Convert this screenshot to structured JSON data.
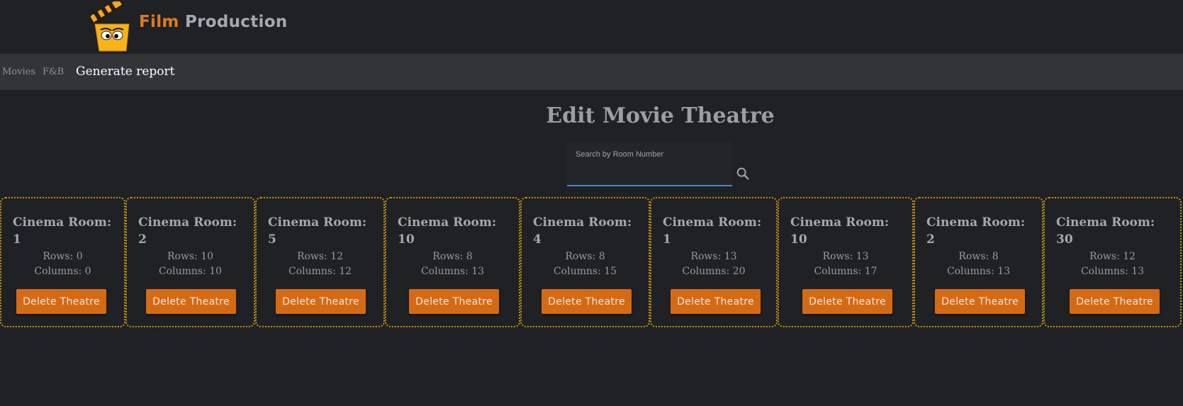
{
  "brand": {
    "word1": "Film",
    "word2": "Production",
    "logo_icon": "clapperboard-mascot-icon",
    "colors": {
      "orange": "#e07a20",
      "grey": "#a7a9ac"
    }
  },
  "nav": {
    "movies": "Movies",
    "fnb": "F&B",
    "report": "Generate report"
  },
  "page": {
    "title": "Edit Movie Theatre"
  },
  "search": {
    "label": "Search by Room Number",
    "value": "",
    "icon": "search-icon",
    "underline_color": "#4a86d8"
  },
  "theatres": [
    {
      "title": "Cinema Room: 1",
      "rows": "Rows: 0",
      "columns": "Columns: 0",
      "button": "Delete Theatre"
    },
    {
      "title": "Cinema Room: 2",
      "rows": "Rows: 10",
      "columns": "Columns: 10",
      "button": "Delete Theatre"
    },
    {
      "title": "Cinema Room: 5",
      "rows": "Rows: 12",
      "columns": "Columns: 12",
      "button": "Delete Theatre"
    },
    {
      "title": "Cinema Room: 10",
      "rows": "Rows: 8",
      "columns": "Columns: 13",
      "button": "Delete Theatre"
    },
    {
      "title": "Cinema Room: 4",
      "rows": "Rows: 8",
      "columns": "Columns: 15",
      "button": "Delete Theatre"
    },
    {
      "title": "Cinema Room: 1",
      "rows": "Rows: 13",
      "columns": "Columns: 20",
      "button": "Delete Theatre"
    },
    {
      "title": "Cinema Room: 10",
      "rows": "Rows: 13",
      "columns": "Columns: 17",
      "button": "Delete Theatre"
    },
    {
      "title": "Cinema Room: 2",
      "rows": "Rows: 8",
      "columns": "Columns: 13",
      "button": "Delete Theatre"
    },
    {
      "title": "Cinema Room: 30",
      "rows": "Rows: 12",
      "columns": "Columns: 13",
      "button": "Delete Theatre"
    }
  ],
  "colors": {
    "background": "#1f2124",
    "navbar": "#333436",
    "card_border": "#c8920f",
    "delete_button": "#d56a15"
  }
}
